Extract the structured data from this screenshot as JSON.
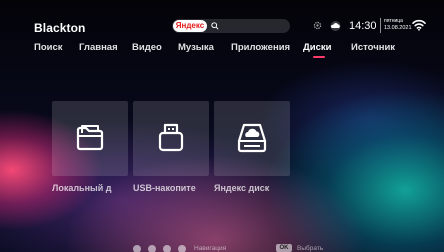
{
  "header": {
    "brand": "Blackton",
    "search": {
      "badge": "Яндекс",
      "placeholder": ""
    },
    "time": "14:30",
    "day": "пятница",
    "date": "13.08.2021"
  },
  "tabs": [
    {
      "label": "Поиск"
    },
    {
      "label": "Главная"
    },
    {
      "label": "Видео"
    },
    {
      "label": "Музыка"
    },
    {
      "label": "Приложения"
    },
    {
      "label": "Диски",
      "active": true
    },
    {
      "label": "Источник"
    }
  ],
  "tiles": [
    {
      "label": "Локальный д",
      "icon": "folder-icon"
    },
    {
      "label": "USB-накопите",
      "icon": "usb-drive-icon"
    },
    {
      "label": "Яндекс диск",
      "icon": "cloud-disk-icon"
    }
  ],
  "hints": {
    "navigation": "Навигация",
    "ok_key": "OK",
    "select": "Выбрать"
  },
  "colors": {
    "accent": "#ff3b6b",
    "yandex_red": "#e21a1a"
  }
}
